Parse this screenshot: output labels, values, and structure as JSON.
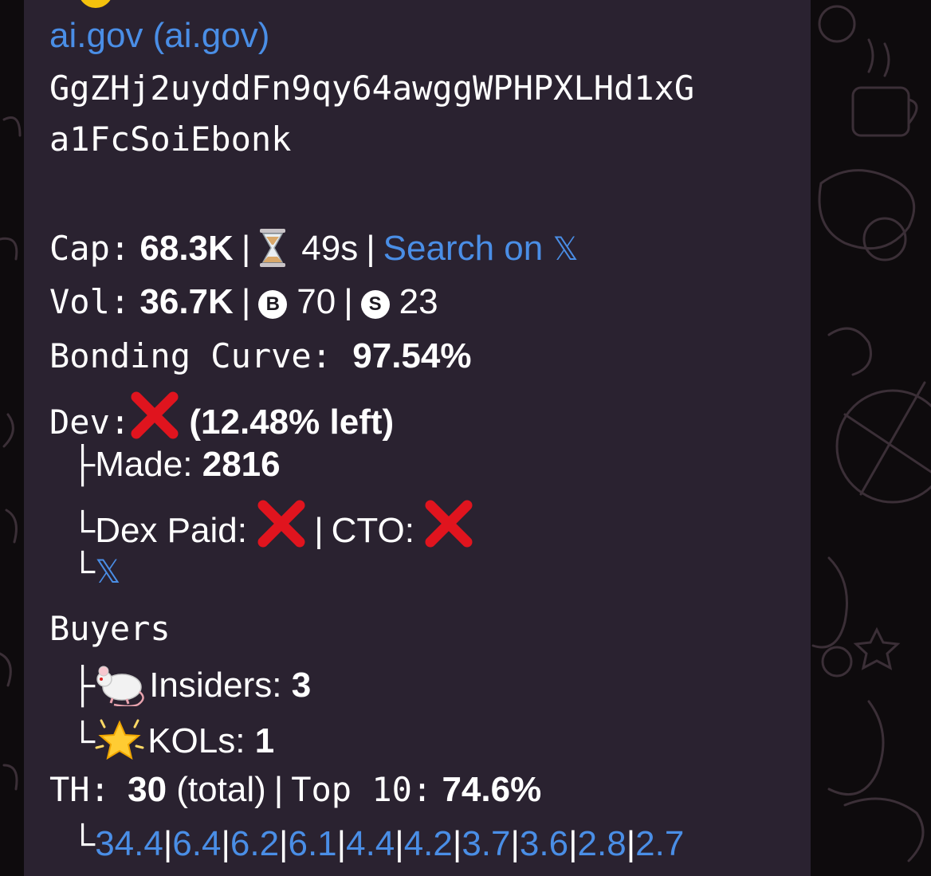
{
  "header": {
    "link": "ai.gov (ai.gov)",
    "address_line1": "GgZHj2uyddFn9qy64awggWPHPXLHd1xG",
    "address_line2": "a1FcSoiEbonk"
  },
  "cap": {
    "label": "Cap:",
    "value": "68.3K",
    "time": "49s",
    "search_link": "Search on",
    "hourglass_icon": "hourglass-icon",
    "x_logo": "𝕏"
  },
  "vol": {
    "label": "Vol:",
    "value": "36.7K",
    "buy_badge": "B",
    "buys": "70",
    "sell_badge": "S",
    "sells": "23"
  },
  "bonding": {
    "label": "Bonding Curve:",
    "value": "97.54%"
  },
  "dev": {
    "label": "Dev:",
    "left": "(12.48% left)",
    "made_prefix": "├",
    "made_label": "Made:",
    "made_value": "2816",
    "dex_prefix": "└",
    "dex_label": "Dex Paid:",
    "cto_label": "CTO:",
    "x_prefix": "└",
    "x_logo": "𝕏"
  },
  "buyers": {
    "title": "Buyers",
    "insiders_prefix": "├",
    "insiders_label": "Insiders:",
    "insiders_value": "3",
    "kols_prefix": "└",
    "kols_label": "KOLs:",
    "kols_value": "1"
  },
  "th": {
    "label": "TH:",
    "total_value": "30",
    "total_text": "(total)",
    "top_label": "Top 10:",
    "top_value": "74.6%",
    "prefix": "└",
    "holders": [
      "34.4",
      "6.4",
      "6.2",
      "6.1",
      "4.4",
      "4.2",
      "3.7",
      "3.6",
      "2.8",
      "2.7"
    ]
  },
  "colors": {
    "bubble": "#2a2230",
    "link": "#4a8ee6",
    "cross": "#e0141e",
    "background": "#0e0b0d"
  }
}
